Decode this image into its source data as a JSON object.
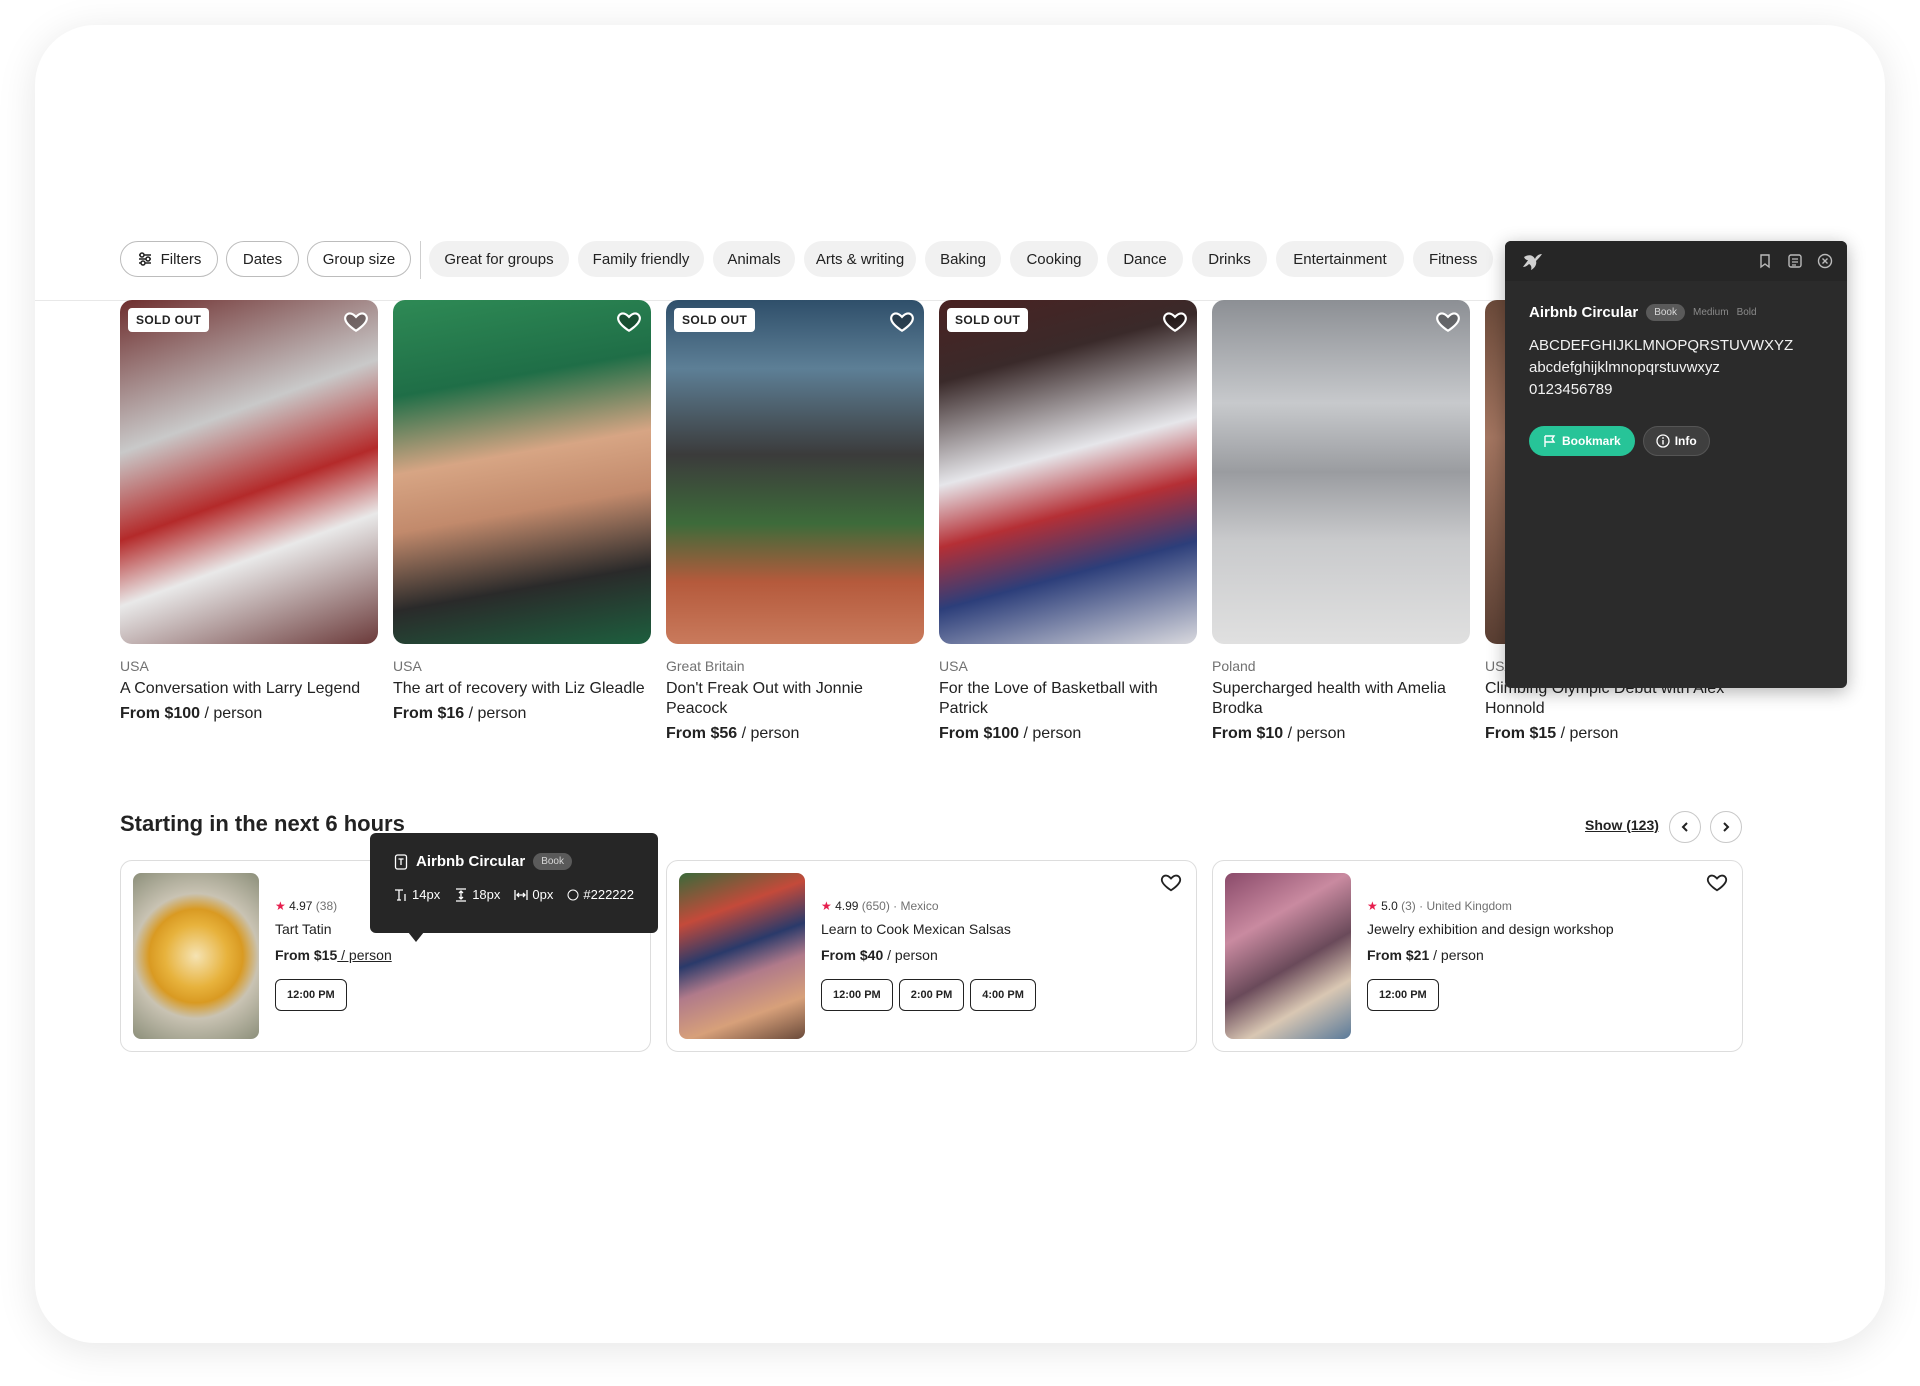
{
  "filters": {
    "buttons": [
      {
        "label": "Filters",
        "icon": "sliders-icon"
      },
      {
        "label": "Dates"
      },
      {
        "label": "Group size"
      }
    ],
    "categories": [
      "Great for groups",
      "Family friendly",
      "Animals",
      "Arts & writing",
      "Baking",
      "Cooking",
      "Dance",
      "Drinks",
      "Entertainment",
      "Fitness"
    ]
  },
  "experiences": [
    {
      "badge": "SOLD OUT",
      "location": "USA",
      "title": "A Conversation with Larry Legend",
      "price": "From $100",
      "unit": " / person"
    },
    {
      "badge": "",
      "location": "USA",
      "title": "The art of recovery with Liz Gleadle",
      "price": "From $16",
      "unit": " / person"
    },
    {
      "badge": "SOLD OUT",
      "location": "Great Britain",
      "title": "Don't Freak Out with Jonnie Peacock",
      "price": "From $56",
      "unit": " / person"
    },
    {
      "badge": "SOLD OUT",
      "location": "USA",
      "title": "For the Love of Basketball with Patrick",
      "price": "From $100",
      "unit": " / person"
    },
    {
      "badge": "",
      "location": "Poland",
      "title": "Supercharged health with Amelia Brodka",
      "price": "From $10",
      "unit": " / person"
    },
    {
      "badge": "",
      "location": "USA",
      "title": "Climbing Olympic Debut with Alex Honnold",
      "price": "From $15",
      "unit": " / person"
    }
  ],
  "upcoming": {
    "title": "Starting in the next 6 hours",
    "show_all": "Show (123)",
    "items": [
      {
        "rating": "4.97",
        "meta": " (38)",
        "title": "Tart Tatin",
        "price": "From $15",
        "unit": " / person",
        "times": [
          "12:00 PM"
        ]
      },
      {
        "rating": "4.99",
        "meta": " (650) · Mexico",
        "title": "Learn to Cook Mexican Salsas",
        "price": "From $40",
        "unit": " / person",
        "times": [
          "12:00 PM",
          "2:00 PM",
          "4:00 PM"
        ]
      },
      {
        "rating": "5.0",
        "meta": " (3) · United Kingdom",
        "title": "Jewelry exhibition and design workshop",
        "price": "From $21",
        "unit": " / person",
        "times": [
          "12:00 PM"
        ]
      }
    ]
  },
  "font_tooltip": {
    "font_name": "Airbnb Circular",
    "weight": "Book",
    "size": "14px",
    "line_height": "18px",
    "letter_spacing": "0px",
    "color": "#222222"
  },
  "font_panel": {
    "font_name": "Airbnb Circular",
    "weights": [
      "Book",
      "Medium",
      "Bold"
    ],
    "uppercase": "ABCDEFGHIJKLMNOPQRSTUVWXYZ",
    "lowercase": "abcdefghijklmnopqrstuvwxyz",
    "digits": "0123456789",
    "bookmark_label": "Bookmark",
    "info_label": "Info"
  },
  "colors": {
    "accent_green": "#27c498",
    "star_red": "#e61e4d",
    "text_primary": "#222222",
    "text_secondary": "#717171"
  }
}
